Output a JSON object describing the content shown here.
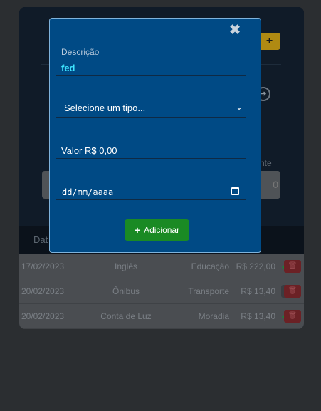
{
  "background": {
    "add_icon": "plus-icon",
    "balance_label": "nte",
    "balance_value": "0",
    "table_header": "Dat"
  },
  "table": {
    "rows": [
      {
        "date": "17/02/2023",
        "description": "Inglês",
        "type": "Educação",
        "value": "R$ 222,00",
        "status": "paid"
      },
      {
        "date": "20/02/2023",
        "description": "Ônibus",
        "type": "Transporte",
        "value": "R$ 13,40",
        "status": "pending"
      },
      {
        "date": "20/02/2023",
        "description": "Conta de Luz",
        "type": "Moradia",
        "value": "R$ 13,40",
        "status": "paid"
      }
    ]
  },
  "modal": {
    "close_icon": "✖",
    "description_label": "Descrição",
    "description_value": "fed",
    "type_select": "Selecione um tipo...",
    "value_placeholder": "Valor R$ 0,00",
    "date_placeholder": "dd/mm/aaaa",
    "submit_label": "Adicionar"
  },
  "colors": {
    "modal_bg": "#004a85",
    "submit_bg": "#1a8a24",
    "highlight_text": "#3ee4ff"
  }
}
